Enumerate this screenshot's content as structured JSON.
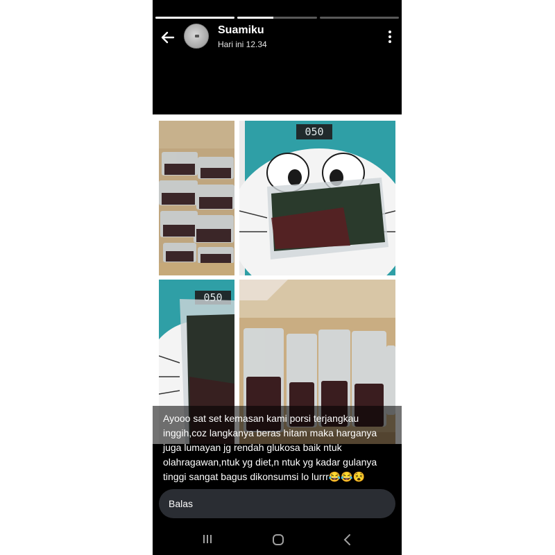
{
  "story": {
    "progress_segments": [
      1,
      0.45,
      0
    ],
    "user_name": "Suamiku",
    "timestamp": "Hari ini 12.34",
    "scale_reading_1": "050",
    "scale_reading_2": "050",
    "caption": "Ayooo sat set kemasan kami porsi terjangkau inggih,coz langkanya beras hitam maka harganya juga lumayan jg rendah glukosa baik ntuk olahragawan,ntuk yg diet,n ntuk yg kadar gulanya tinggi sangat bagus dikonsumsi lo lurrr😂😂😵",
    "reply_placeholder": "Balas"
  },
  "icons": {
    "back": "arrow-left-icon",
    "menu": "more-vertical-icon",
    "nav_recent": "recent-apps-icon",
    "nav_home": "home-icon",
    "nav_back": "nav-back-icon"
  },
  "colors": {
    "phone_bg": "#000000",
    "reply_bg": "#2a2d33",
    "scale_teal": "#2f9fa6",
    "rice_dark": "#3a1d1f"
  }
}
